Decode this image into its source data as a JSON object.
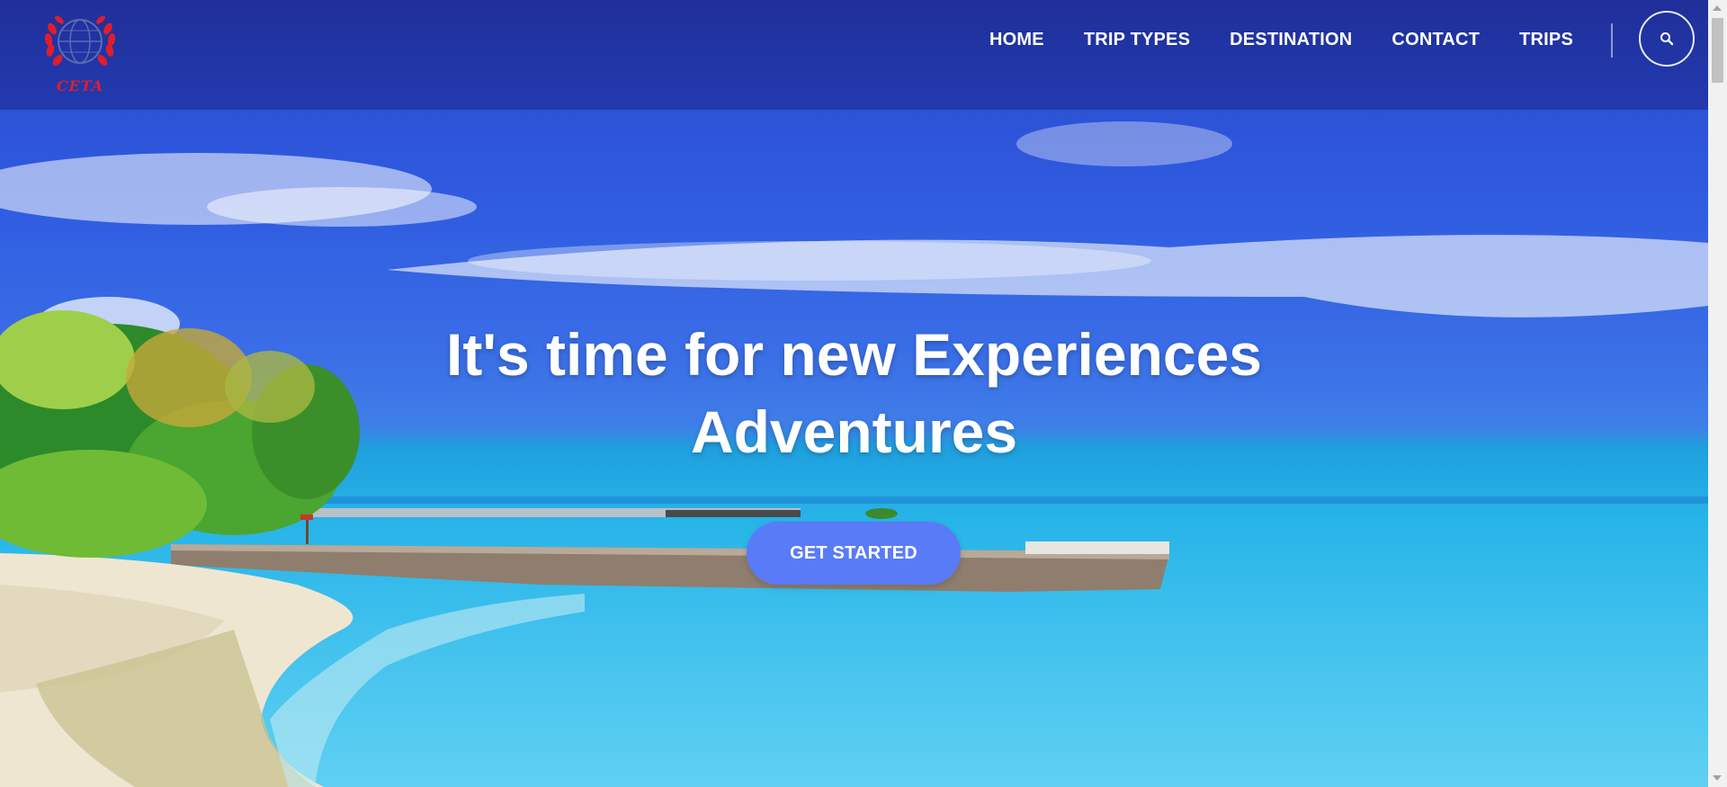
{
  "brand": {
    "logo_text": "CETA"
  },
  "nav": {
    "items": [
      {
        "label": "HOME"
      },
      {
        "label": "TRIP TYPES"
      },
      {
        "label": "DESTINATION"
      },
      {
        "label": "CONTACT"
      },
      {
        "label": "TRIPS"
      }
    ],
    "search_icon": "search-icon"
  },
  "hero": {
    "headline_line1": "It's time for new Experiences",
    "headline_line2": "Adventures",
    "cta_label": "GET STARTED"
  },
  "colors": {
    "nav_bg": "#1e2d96",
    "cta_bg": "#5a7bf7",
    "logo_red": "#e01e2a"
  }
}
